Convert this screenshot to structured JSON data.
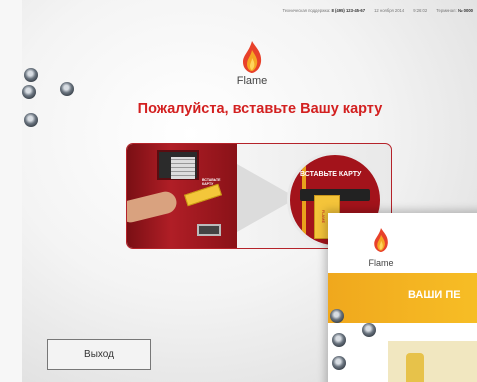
{
  "statusbar": {
    "support": "Техническая поддержка:",
    "phone": "8 (495) 123-45-67",
    "date": "12 ноября 2014",
    "time": "9:26:02",
    "terminal_label": "Терминал:",
    "terminal_id": "№ 0000"
  },
  "brand": {
    "name": "Flame"
  },
  "headline": "Пожалуйста, вставьте Вашу карту",
  "illustration": {
    "slot_label": "ВСТАВЬТЕ КАРТУ",
    "card_text": "FLAME"
  },
  "exit_button": "Выход",
  "overlay": {
    "brand": "Flame",
    "banner": "ВАШИ ПЕ"
  },
  "colors": {
    "accent": "#d32020",
    "banner": "#f3b223"
  }
}
